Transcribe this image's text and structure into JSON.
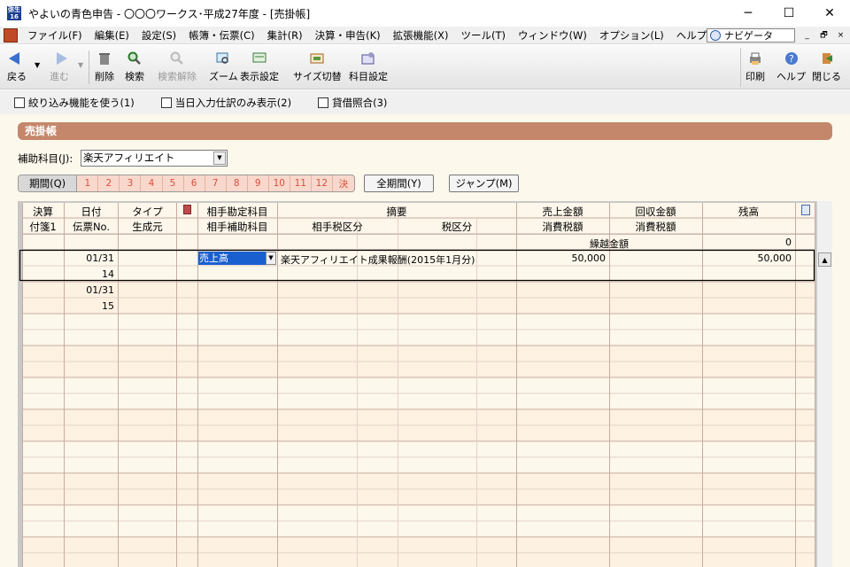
{
  "window": {
    "title": "やよいの青色申告 - 〇〇〇ワークス･平成27年度 - [売掛帳]",
    "app_icon_text": "弥生16",
    "minimize": "─",
    "maximize": "☐",
    "close": "✕"
  },
  "menu": {
    "items": [
      "ファイル(F)",
      "編集(E)",
      "設定(S)",
      "帳簿・伝票(C)",
      "集計(R)",
      "決算・申告(K)",
      "拡張機能(X)",
      "ツール(T)",
      "ウィンドウ(W)",
      "オプション(L)",
      "ヘルプ(H)"
    ],
    "navigator": "ナビゲータ",
    "mdi_min": "_",
    "mdi_restore": "🗗",
    "mdi_close": "×"
  },
  "toolbar": {
    "back": "戻る",
    "forward": "進む",
    "delete": "削除",
    "search": "検索",
    "search_clear": "検索解除",
    "zoom": "ズーム",
    "display_settings": "表示設定",
    "size_toggle": "サイズ切替",
    "account_settings": "科目設定",
    "print": "印刷",
    "help": "ヘルプ",
    "close": "閉じる"
  },
  "options": {
    "filter": "絞り込み機能を使う(1)",
    "today_only": "当日入力仕訳のみ表示(2)",
    "balance_check": "貸借照合(3)"
  },
  "ledger": {
    "section_title": "売掛帳",
    "sub_account_label": "補助科目(J):",
    "sub_account_value": "楽天アフィリエイト",
    "period_label": "期間(Q)",
    "months": [
      "1",
      "2",
      "3",
      "4",
      "5",
      "6",
      "7",
      "8",
      "9",
      "10",
      "11",
      "12",
      "決"
    ],
    "all_period_button": "全期間(Y)",
    "jump_button": "ジャンプ(M)",
    "headers": {
      "row1": [
        "決算",
        "日付",
        "タイプ",
        "相手勘定科目",
        "摘要",
        "売上金額",
        "回収金額",
        "残高"
      ],
      "row2": [
        "付箋1",
        "伝票No.",
        "生成元",
        "相手補助科目",
        "相手税区分",
        "税区分",
        "消費税額",
        "消費税額"
      ]
    },
    "carry_forward_label": "繰越金額",
    "carry_forward_value": "0",
    "rows": [
      {
        "date": "01/31",
        "slip": "14",
        "account": "売上高",
        "description": "楽天アフィリエイト成果報酬(2015年1月分)",
        "sales": "50,000",
        "collected": "",
        "balance": "50,000"
      },
      {
        "date": "01/31",
        "slip": "15",
        "account": "",
        "description": "",
        "sales": "",
        "collected": "",
        "balance": ""
      }
    ]
  }
}
